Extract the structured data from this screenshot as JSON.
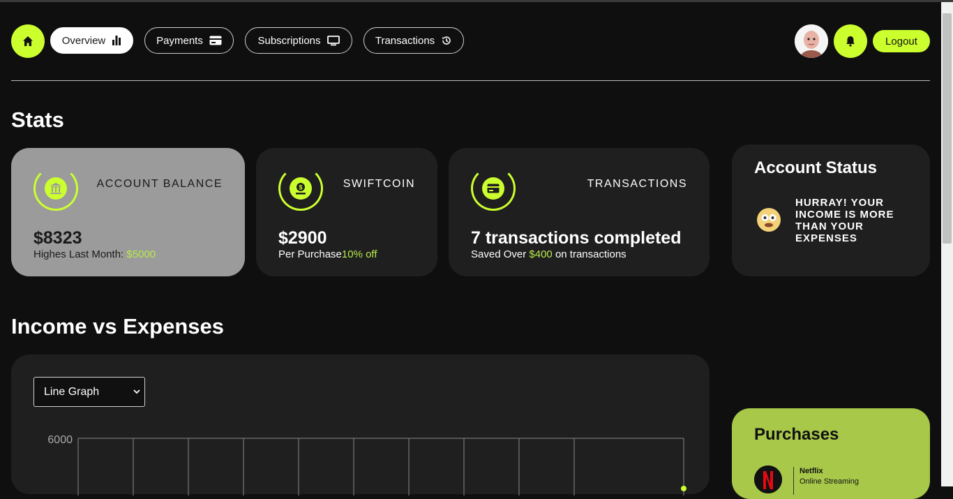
{
  "nav": {
    "tabs": [
      {
        "label": "Overview",
        "icon": "bar-chart-icon"
      },
      {
        "label": "Payments",
        "icon": "credit-card-icon"
      },
      {
        "label": "Subscriptions",
        "icon": "monitor-icon"
      },
      {
        "label": "Transactions",
        "icon": "history-icon"
      }
    ],
    "logout_label": "Logout"
  },
  "stats": {
    "heading": "Stats",
    "cards": [
      {
        "title": "ACCOUNT BALANCE",
        "icon": "bank-icon",
        "value": "$8323",
        "sub_prefix": "Highes Last Month:",
        "sub_accent": "$5000",
        "sub_suffix": ""
      },
      {
        "title": "SWIFTCOIN",
        "icon": "coin-icon",
        "value": "$2900",
        "sub_prefix": "Per Purchase",
        "sub_accent": "10% off",
        "sub_suffix": ""
      },
      {
        "title": "TRANSACTIONS",
        "icon": "card-icon",
        "value": "7 transactions completed",
        "sub_prefix": "Saved Over",
        "sub_accent": "$400",
        "sub_suffix": "on transactions"
      }
    ]
  },
  "account_status": {
    "title": "Account Status",
    "message": "HURRAY! YOUR INCOME IS MORE THAN YOUR EXPENSES"
  },
  "income": {
    "heading": "Income vs Expenses",
    "graph_select": "Line Graph"
  },
  "chart_data": {
    "type": "line",
    "title": "",
    "xlabel": "",
    "ylabel": "",
    "y_ticks_visible": [
      "6000"
    ],
    "grid": true
  },
  "purchases": {
    "title": "Purchases",
    "items": [
      {
        "name": "Netflix",
        "sub": "Online Streaming"
      }
    ]
  },
  "colors": {
    "accent": "#ccff2e",
    "accent_text": "#b8e94c",
    "background": "#0f0f0f",
    "card": "#1f1f1f",
    "card_highlight": "#9b9b9b",
    "purchases_card": "#a8c84a"
  }
}
